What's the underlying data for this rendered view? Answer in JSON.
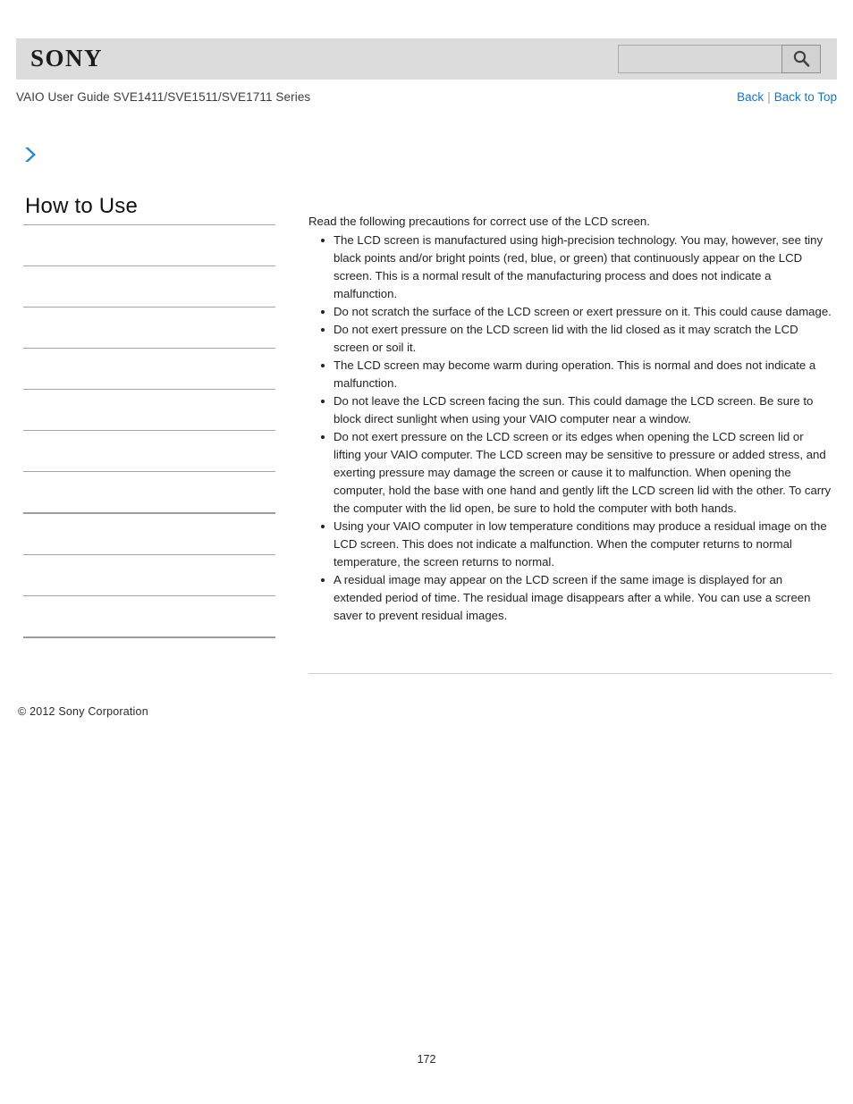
{
  "header": {
    "logo_text": "SONY",
    "search": {
      "value": "",
      "placeholder": "",
      "icon": "search-icon",
      "button_label": ""
    }
  },
  "subheader": {
    "guide_title": "VAIO User Guide SVE1411/SVE1511/SVE1711 Series",
    "links": {
      "back": "Back",
      "separator": "|",
      "back_to_top": "Back to Top"
    }
  },
  "breadcrumb": {
    "icon": "chevron-right-icon"
  },
  "sidebar": {
    "title": "How to Use",
    "items": [
      {
        "label": ""
      },
      {
        "label": ""
      },
      {
        "label": ""
      },
      {
        "label": ""
      },
      {
        "label": ""
      },
      {
        "label": ""
      },
      {
        "label": ""
      },
      {
        "label": ""
      },
      {
        "label": ""
      },
      {
        "label": ""
      }
    ]
  },
  "main": {
    "intro": "Read the following precautions for correct use of the LCD screen.",
    "bullets": [
      "The LCD screen is manufactured using high-precision technology. You may, however, see tiny black points and/or bright points (red, blue, or green) that continuously appear on the LCD screen. This is a normal result of the manufacturing process and does not indicate a malfunction.",
      "Do not scratch the surface of the LCD screen or exert pressure on it. This could cause damage.",
      "Do not exert pressure on the LCD screen lid with the lid closed as it may scratch the LCD screen or soil it.",
      "The LCD screen may become warm during operation. This is normal and does not indicate a malfunction.",
      "Do not leave the LCD screen facing the sun. This could damage the LCD screen. Be sure to block direct sunlight when using your VAIO computer near a window.",
      "Do not exert pressure on the LCD screen or its edges when opening the LCD screen lid or lifting your VAIO computer. The LCD screen may be sensitive to pressure or added stress, and exerting pressure may damage the screen or cause it to malfunction. When opening the computer, hold the base with one hand and gently lift the LCD screen lid with the other. To carry the computer with the lid open, be sure to hold the computer with both hands.",
      "Using your VAIO computer in low temperature conditions may produce a residual image on the LCD screen. This does not indicate a malfunction. When the computer returns to normal temperature, the screen returns to normal.",
      "A residual image may appear on the LCD screen if the same image is displayed for an extended period of time. The residual image disappears after a while. You can use a screen saver to prevent residual images."
    ]
  },
  "footer": {
    "copyright": "© 2012 Sony Corporation",
    "page_number": "172"
  },
  "colors": {
    "header_band": "#dcdcdc",
    "link_blue": "#1a73c8",
    "chevron_blue": "#2b87c8",
    "rule_gray": "#a5a5a5"
  }
}
